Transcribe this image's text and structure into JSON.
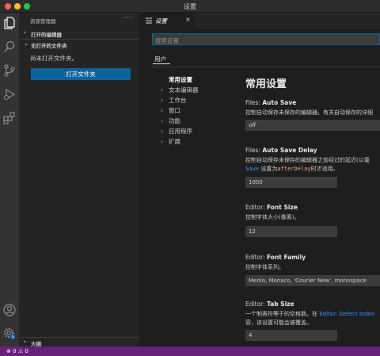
{
  "window": {
    "title": "设置"
  },
  "sidebar": {
    "header": "资源管理器",
    "more_label": "···",
    "open_editors": "打开的编辑器",
    "no_folder_section": "无打开的文件夹",
    "no_folder_message": "尚未打开文件夹。",
    "open_folder_button": "打开文件夹",
    "outline": "大纲"
  },
  "editor": {
    "tab_label": "设置",
    "tab_close": "×",
    "search_placeholder": "搜索设置",
    "scope_tab": "用户"
  },
  "toc": [
    {
      "label": "常用设置",
      "active": true,
      "chevron": ""
    },
    {
      "label": "文本编辑器",
      "active": false,
      "chevron": "›"
    },
    {
      "label": "工作台",
      "active": false,
      "chevron": "›"
    },
    {
      "label": "窗口",
      "active": false,
      "chevron": "›"
    },
    {
      "label": "功能",
      "active": false,
      "chevron": "›"
    },
    {
      "label": "应用程序",
      "active": false,
      "chevron": "›"
    },
    {
      "label": "扩展",
      "active": false,
      "chevron": "›"
    }
  ],
  "settings": {
    "section_title": "常用设置",
    "auto_save": {
      "category": "Files: ",
      "name": "Auto Save",
      "description": "控制自动保存未保存的编辑器。有关自动保存的详细",
      "value": "off"
    },
    "auto_save_delay": {
      "category": "Files: ",
      "name": "Auto Save Delay",
      "description_line1": "控制自动保存未保存的编辑器之前经过的延迟(以毫",
      "description_line2_link": "Save",
      "description_line2_mid": " 设置为",
      "description_line2_code": "afterDelay",
      "description_line2_end": "时才适用。",
      "value": "1000"
    },
    "font_size": {
      "category": "Editor: ",
      "name": "Font Size",
      "description": "控制字体大小(像素)。",
      "value": "12"
    },
    "font_family": {
      "category": "Editor: ",
      "name": "Font Family",
      "description": "控制字体系列。",
      "value": "Menlo, Monaco, 'Courier New', monospace"
    },
    "tab_size": {
      "category": "Editor: ",
      "name": "Tab Size",
      "description_line1_text": "一个制表符等于的空格数。在 ",
      "description_line1_link": "Editor: Detect Inden",
      "description_line2": "容，该设置可能会被覆盖。",
      "value": "4"
    }
  },
  "statusbar": {
    "errors": "0",
    "warnings": "0"
  },
  "colors": {
    "accent": "#0e639c",
    "statusbar": "#68217a",
    "link": "#3794ff"
  }
}
